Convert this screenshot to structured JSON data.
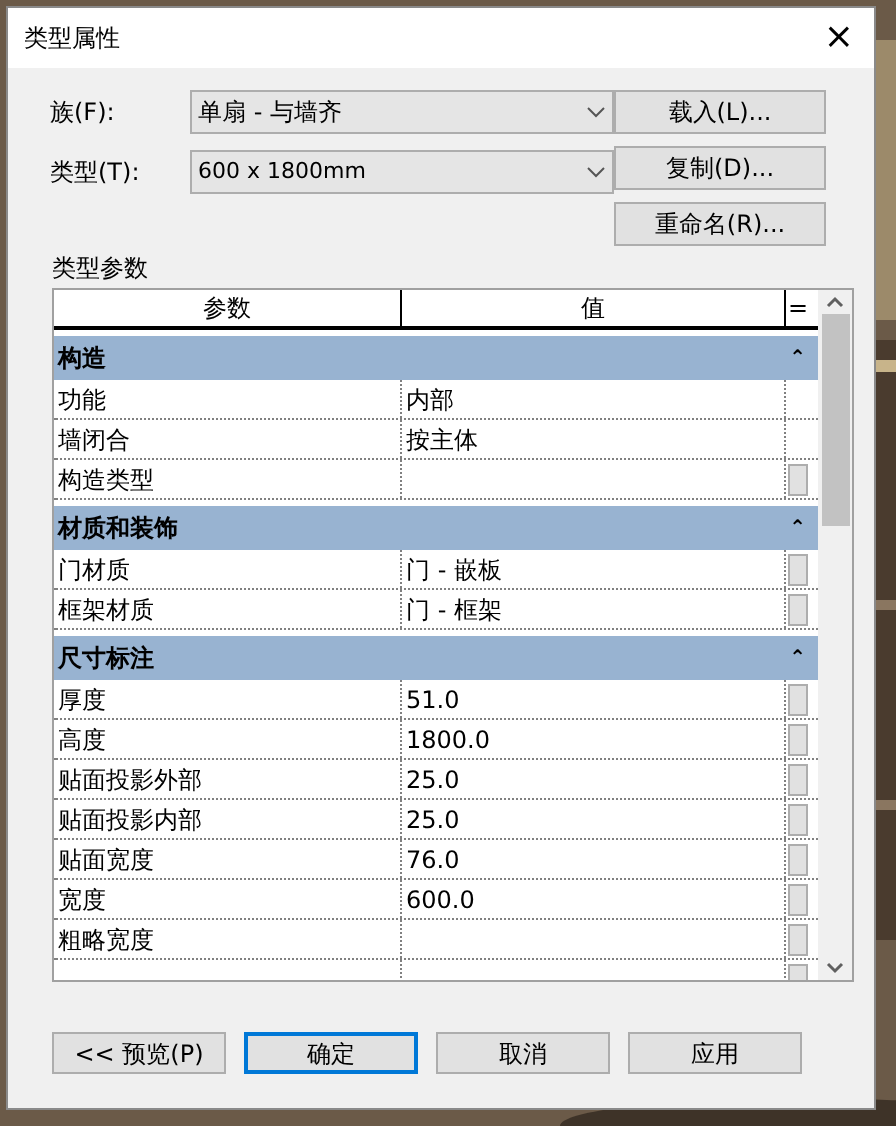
{
  "window": {
    "title": "类型属性",
    "close": "×"
  },
  "fields": [
    {
      "label": "族(F):",
      "value": "单扇 - 与墙齐"
    },
    {
      "label": "类型(T):",
      "value": "600 x 1800mm"
    }
  ],
  "side_buttons": [
    "载入(L)...",
    "复制(D)...",
    "重命名(R)..."
  ],
  "section_label": "类型参数",
  "table": {
    "columns": [
      "参数",
      "值",
      "="
    ],
    "groups": [
      {
        "title": "构造",
        "toggle": "⌃",
        "rows": [
          {
            "name": "功能",
            "value": "内部",
            "linkable": false
          },
          {
            "name": "墙闭合",
            "value": "按主体",
            "linkable": false
          },
          {
            "name": "构造类型",
            "value": "",
            "linkable": true
          }
        ]
      },
      {
        "title": "材质和装饰",
        "toggle": "⌃",
        "rows": [
          {
            "name": "门材质",
            "value": "门 - 嵌板",
            "linkable": true
          },
          {
            "name": "框架材质",
            "value": "门 - 框架",
            "linkable": true
          }
        ]
      },
      {
        "title": "尺寸标注",
        "toggle": "⌃",
        "rows": [
          {
            "name": "厚度",
            "value": "51.0",
            "linkable": true
          },
          {
            "name": "高度",
            "value": "1800.0",
            "linkable": true
          },
          {
            "name": "贴面投影外部",
            "value": "25.0",
            "linkable": true
          },
          {
            "name": "贴面投影内部",
            "value": "25.0",
            "linkable": true
          },
          {
            "name": "贴面宽度",
            "value": "76.0",
            "linkable": true
          },
          {
            "name": "宽度",
            "value": "600.0",
            "linkable": true
          },
          {
            "name": "粗略宽度",
            "value": "",
            "linkable": true
          },
          {
            "name": "",
            "value": "",
            "linkable": true
          }
        ]
      }
    ]
  },
  "buttons": [
    {
      "label": "<< 预览(P)",
      "default": false
    },
    {
      "label": "确定",
      "default": true
    },
    {
      "label": "取消",
      "default": false
    },
    {
      "label": "应用",
      "default": false
    }
  ]
}
